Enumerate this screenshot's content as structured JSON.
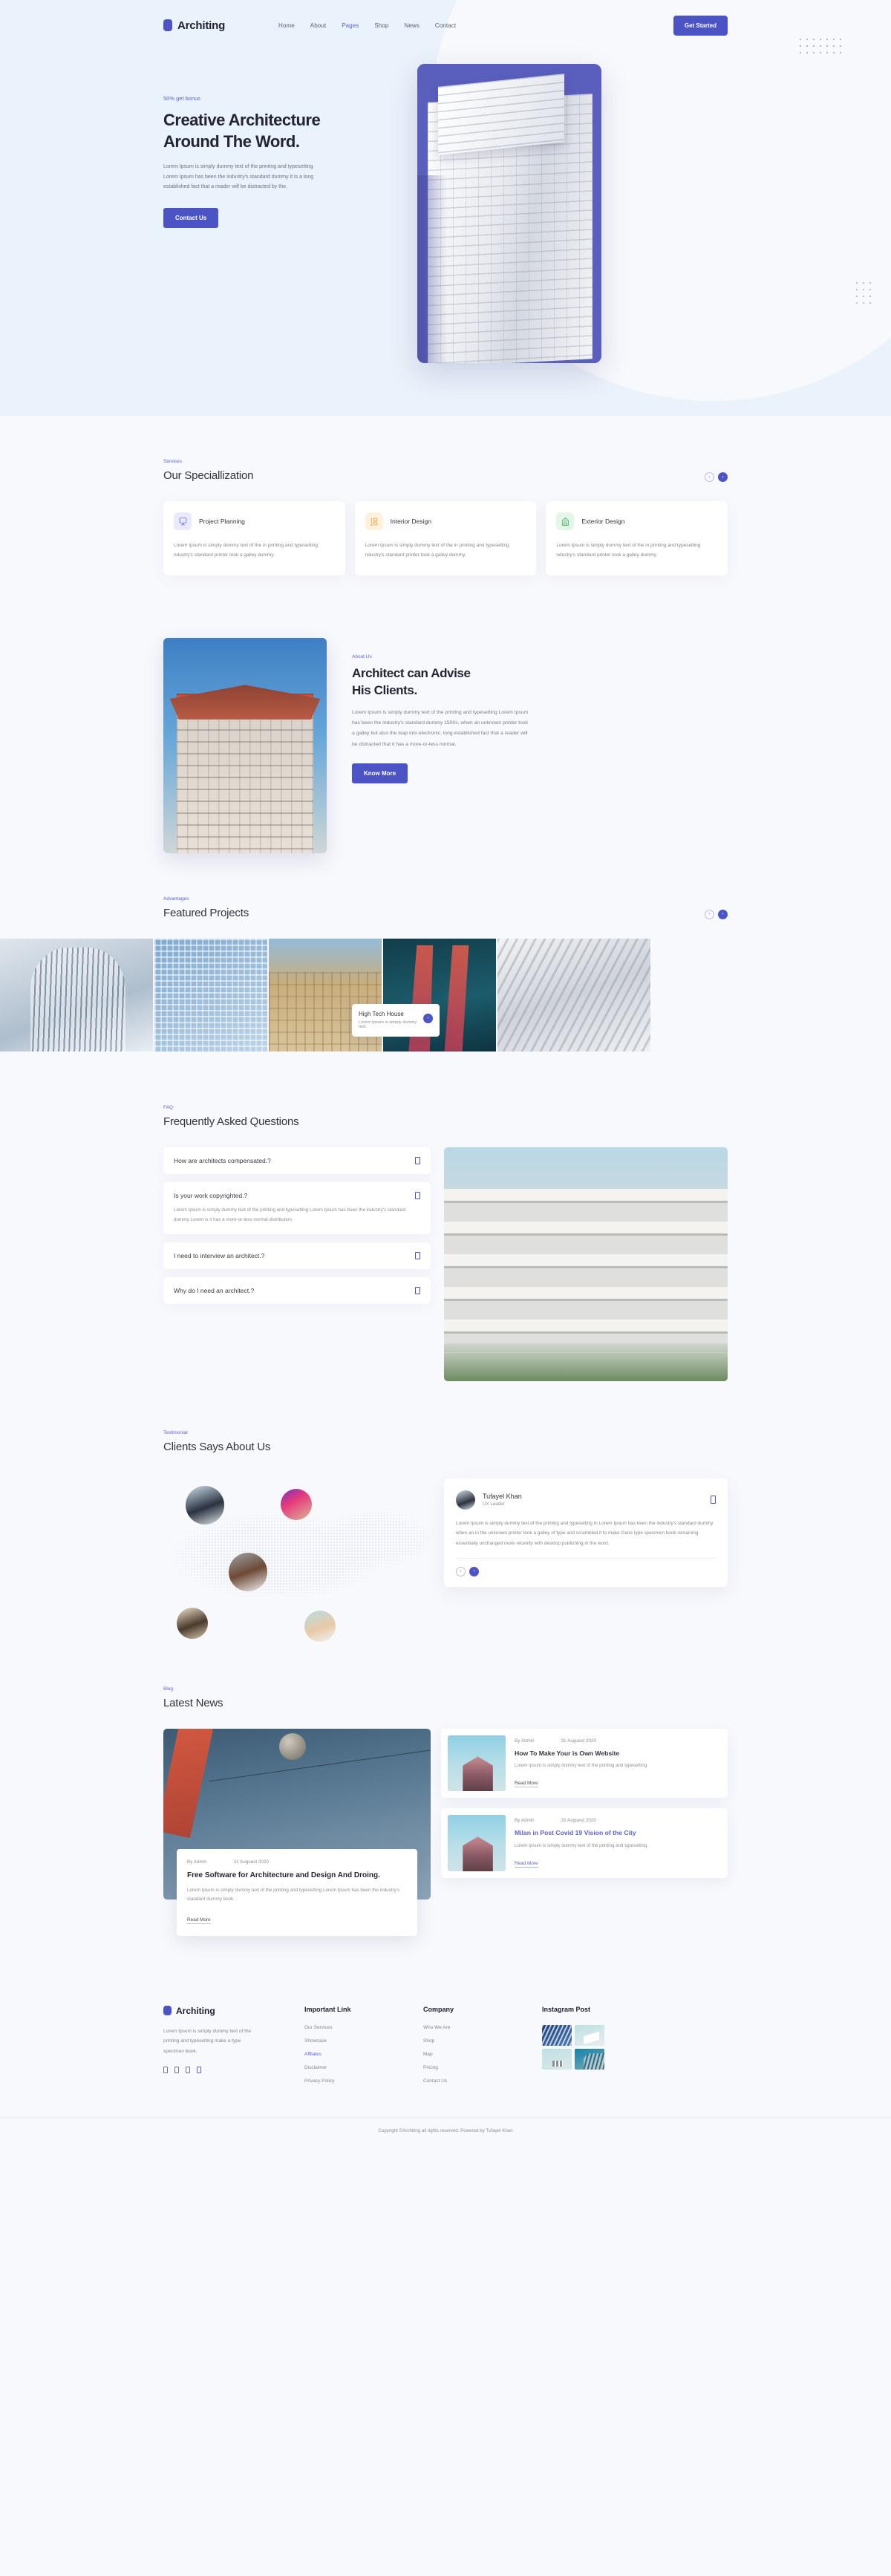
{
  "brand": {
    "name": "Architing",
    "mark": "logo-mark"
  },
  "nav": {
    "items": [
      {
        "label": "Home",
        "active": false
      },
      {
        "label": "About",
        "active": false
      },
      {
        "label": "Pages",
        "active": true
      },
      {
        "label": "Shop",
        "active": false
      },
      {
        "label": "News",
        "active": false
      },
      {
        "label": "Contact",
        "active": false
      }
    ],
    "cta": "Get Started"
  },
  "hero": {
    "eyebrow": "50% get bonus",
    "title_line1": "Creative Architecture",
    "title_line2": "Around The Word.",
    "paragraph": "Lorem Ipsum is simply dummy text of the printing and typesetting Lorem Ipsum has been the industry's standard dummy it is a long established fact that a reader will be distracted by the.",
    "cta": "Contact Us"
  },
  "services": {
    "eyebrow": "Services",
    "title": "Our Speciallization",
    "prev": "‹",
    "next": "›",
    "cards": [
      {
        "title": "Project Planning",
        "icon": "easel-icon",
        "text": "Lorem Ipsum is simply dummy text of the in printing and typesetting ndustry's standard printer took a galley dummy."
      },
      {
        "title": "Interior Design",
        "icon": "lamp-icon",
        "text": "Lorem Ipsum is simply dummy text of the in printing and typesetting ndustry's standard printer took a galley dummy."
      },
      {
        "title": "Exterior Design",
        "icon": "building-icon",
        "text": "Lorem Ipsum is simply dummy text of the in printing and typesetting ndustry's standard printer took a galley dummy."
      }
    ]
  },
  "about": {
    "eyebrow": "About Us",
    "title_line1": "Architect can Advise",
    "title_line2": "His Clients.",
    "paragraph": "Lorem Ipsum is simply dummy text of the printing and typesetting Lorem Ipsum has been the industry's standard dummy 1500s, when an unknown printer took a galley but also the leap into electronic. long established fact that a reader will be distracted  that it has a more-or-less normal.",
    "cta": "Know More"
  },
  "featured": {
    "eyebrow": "Advantages",
    "title": "Featured Projects",
    "prev": "‹",
    "next": "›",
    "card": {
      "title": "High Tech House",
      "subtitle": "Lorem Ipsum is simply dummy text.",
      "button": "›"
    }
  },
  "faq": {
    "eyebrow": "FAQ",
    "title": "Frequently Asked Questions",
    "items": [
      {
        "question": "How are architects compensated.?",
        "answer": "",
        "open": false
      },
      {
        "question": "Is your work copyrighted.?",
        "answer": "Lorem Ipsum is simply dummy text of the printing and typesetting Lorem Ipsum has been the industry's standard dummy Lorem is it has a more-or-less normal distribution.",
        "open": true
      },
      {
        "question": "I need to interview an architect.?",
        "answer": "",
        "open": false
      },
      {
        "question": "Why do I need an architect.?",
        "answer": "",
        "open": false
      }
    ]
  },
  "testimonial": {
    "eyebrow": "Testimonial",
    "title": "Clients Says About Us",
    "name": "Tufayel Khan",
    "role": "UX Leader",
    "quote_icon": "quote-icon",
    "text": "Lorem Ipsum is simply dummy text of the printing and typesetting in Lorem Ipsum has been the industry's standard dummy when an in the unknown printer took a galley of type and scrambled it to make Gane type specimen book remaining essentially unchanged more recently with desktop publishing in the word.",
    "prev": "‹",
    "next": "›"
  },
  "blog": {
    "eyebrow": "Blog",
    "title": "Latest News",
    "main": {
      "author": "By Admin",
      "date": "31 Auguest 2020",
      "title": "Free Software for Architecture and Design And Droing.",
      "text": "Lorem Ipsum is simply dummy text of the printing and typesetting Lorem Ipsum has been the industry's standard dummy book.",
      "readmore": "Read More"
    },
    "side": [
      {
        "author": "By Admin",
        "date": "31 Auguest 2020",
        "title": "How To Make Your is Own Website",
        "text": "Lorem Ipsum is simply dummy text of the printing and typesetting.",
        "readmore": "Read More",
        "accent": false
      },
      {
        "author": "By Admin",
        "date": "31 Auguest 2020",
        "title": "Milan in Post Covid 19 Vision of the City",
        "text": "Lorem Ipsum is simply dummy text of the printing and typesetting.",
        "readmore": "Read More",
        "accent": true
      }
    ]
  },
  "footer": {
    "brand": "Architing",
    "about": "Lorem Ipsum is simply dummy text of the printing and typesetting make a type specimen book.",
    "socials": [
      "facebook-icon",
      "twitter-icon",
      "instagram-icon",
      "linkedin-icon"
    ],
    "columns": [
      {
        "heading": "Important Link",
        "links": [
          {
            "label": "Our Services",
            "accent": false
          },
          {
            "label": "Showcase",
            "accent": false
          },
          {
            "label": "Affliates",
            "accent": true
          },
          {
            "label": "Disclaimer",
            "accent": false
          },
          {
            "label": "Privacy Policy",
            "accent": false
          }
        ]
      },
      {
        "heading": "Company",
        "links": [
          {
            "label": "Who We Are",
            "accent": false
          },
          {
            "label": "Shop",
            "accent": false
          },
          {
            "label": "Map",
            "accent": false
          },
          {
            "label": "Pricing",
            "accent": false
          },
          {
            "label": "Contact Us",
            "accent": false
          }
        ]
      }
    ],
    "instagram_heading": "Instagram Post",
    "copyright": "Copyright ©Architing all rights reserved. Powered by Tufayel Khan"
  },
  "colors": {
    "accent": "#4c53c4",
    "accent_text": "#5a62e0",
    "hero_bg": "#eaf2fb",
    "page_bg": "#f8f9fd",
    "hero_card": "#5a5fbe"
  }
}
